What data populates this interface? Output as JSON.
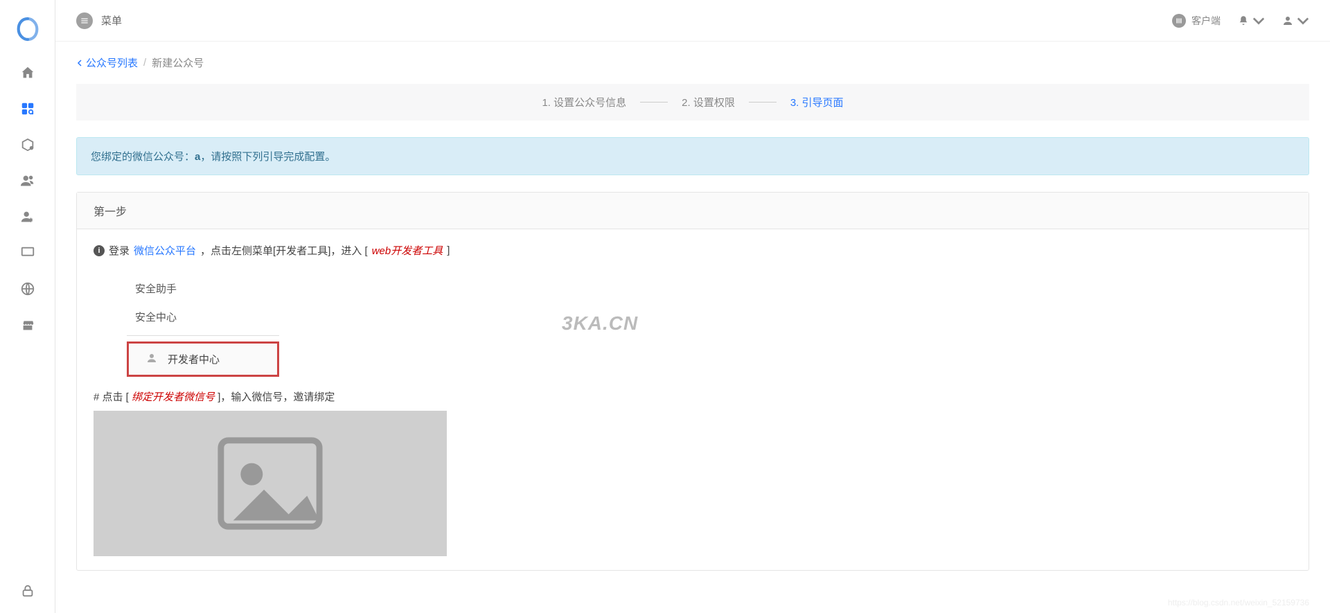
{
  "topbar": {
    "menu_label": "菜单",
    "client_label": "客户端"
  },
  "breadcrumb": {
    "back_label": "公众号列表",
    "separator": "/",
    "current": "新建公众号"
  },
  "steps": [
    {
      "label": "1. 设置公众号信息",
      "active": false
    },
    {
      "label": "2. 设置权限",
      "active": false
    },
    {
      "label": "3. 引导页面",
      "active": true
    }
  ],
  "alert": {
    "prefix": "您绑定的微信公众号：",
    "account_name": "a",
    "suffix": "，请按照下列引导完成配置。"
  },
  "panel": {
    "header": "第一步",
    "instruction": {
      "login": "登录",
      "platform_link": "微信公众平台",
      "text1": "，点击左侧菜单[开发者工具]，进入 [",
      "tool_em": "web开发者工具",
      "text2": " ]"
    },
    "wechat_nav": {
      "items": [
        "安全助手",
        "安全中心"
      ],
      "highlighted": "开发者中心"
    },
    "second_instruction": {
      "prefix": "# 点击 [ ",
      "em": "绑定开发者微信号",
      "suffix": " ]，输入微信号，邀请绑定"
    }
  },
  "watermark": "3KA.CN",
  "footer_watermark": "https://blog.csdn.net/weixin_52159736"
}
